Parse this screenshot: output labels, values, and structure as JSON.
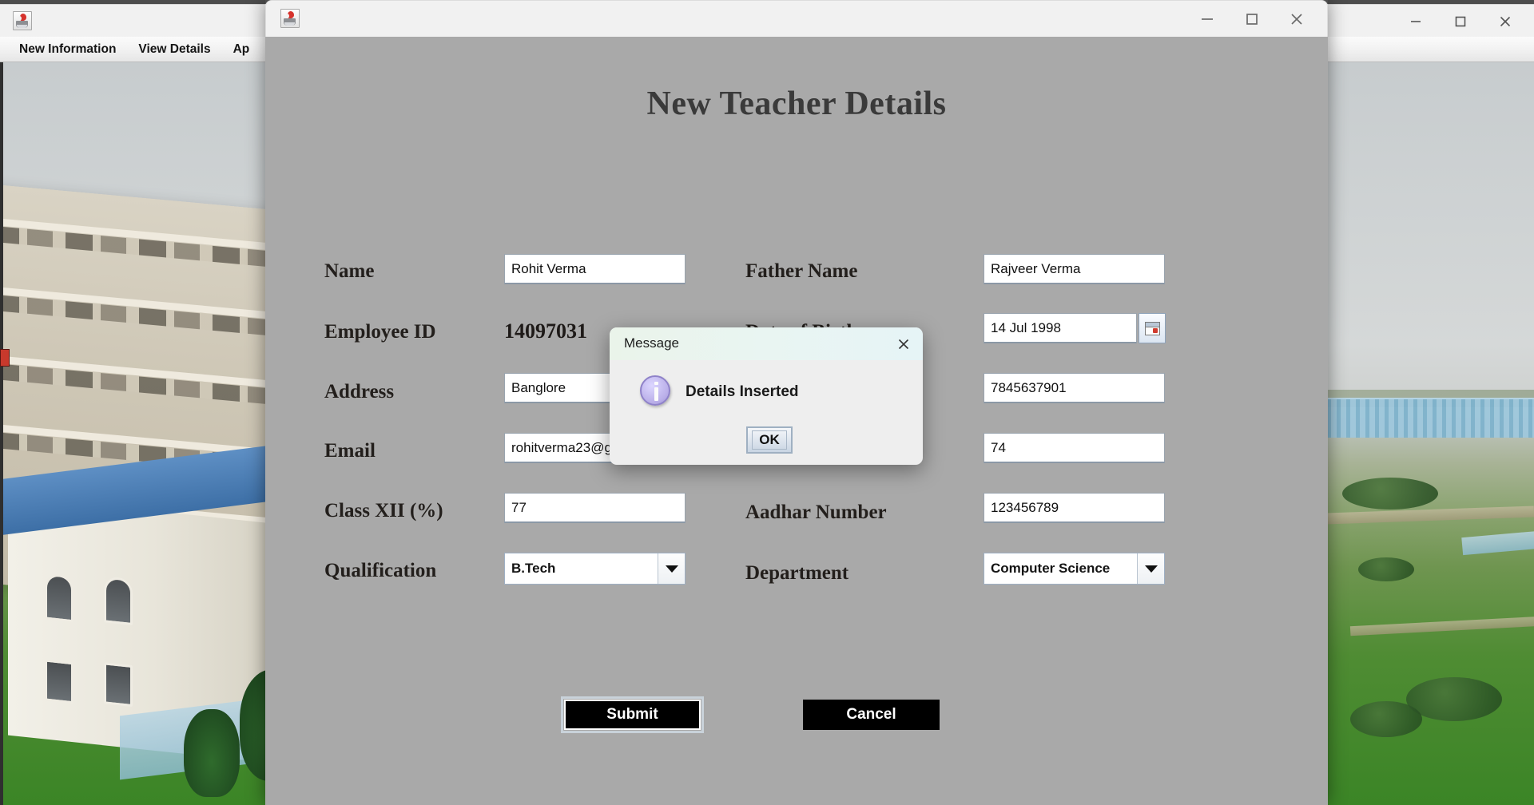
{
  "background_window": {
    "icon": "java-cup-icon",
    "title": "",
    "menu": [
      {
        "label": "New Information"
      },
      {
        "label": "View Details"
      },
      {
        "label": "Ap"
      }
    ],
    "controls": {
      "minimize": "minimize-icon",
      "maximize": "maximize-icon",
      "close": "close-icon"
    }
  },
  "dialog": {
    "icon": "java-cup-icon",
    "title": "",
    "heading": "New Teacher Details",
    "controls": {
      "minimize": "minimize-icon",
      "maximize": "maximize-icon",
      "close": "close-icon"
    },
    "fields": {
      "name": {
        "label": "Name",
        "value": "Rohit Verma",
        "type": "text"
      },
      "father_name": {
        "label": "Father Name",
        "value": "Rajveer Verma",
        "type": "text"
      },
      "employee_id": {
        "label": "Employee ID",
        "value": "14097031",
        "type": "static"
      },
      "date_of_birth": {
        "label": "Date of Birth",
        "value": "14 Jul 1998",
        "type": "date",
        "picker_icon": "calendar-icon"
      },
      "address": {
        "label": "Address",
        "value": "Banglore",
        "type": "text"
      },
      "phone": {
        "label": "",
        "value": "7845637901",
        "type": "text"
      },
      "email": {
        "label": "Email",
        "value": "rohitverma23@g",
        "type": "text"
      },
      "class_x": {
        "label": "",
        "value": "74",
        "type": "text"
      },
      "class_xii": {
        "label": "Class XII (%)",
        "value": "77",
        "type": "text"
      },
      "aadhar_number": {
        "label": "Aadhar Number",
        "value": "123456789",
        "type": "text"
      },
      "qualification": {
        "label": "Qualification",
        "value": "B.Tech",
        "type": "combo",
        "arrow_icon": "chevron-down-icon"
      },
      "department": {
        "label": "Department",
        "value": "Computer Science",
        "type": "combo",
        "arrow_icon": "chevron-down-icon"
      }
    },
    "buttons": {
      "submit": "Submit",
      "cancel": "Cancel"
    }
  },
  "message_dialog": {
    "title": "Message",
    "close_icon": "close-icon",
    "info_icon": "info-icon",
    "text": "Details Inserted",
    "ok_label": "OK"
  },
  "colors": {
    "dialog_background": "#a9a9a9",
    "titlebar": "#f1f1f1",
    "message_titlebar": "#e9f4f0",
    "button_background": "#000000",
    "button_text": "#ffffff",
    "info_icon": "#b9aee8",
    "heading_text": "#3a3a3a"
  }
}
